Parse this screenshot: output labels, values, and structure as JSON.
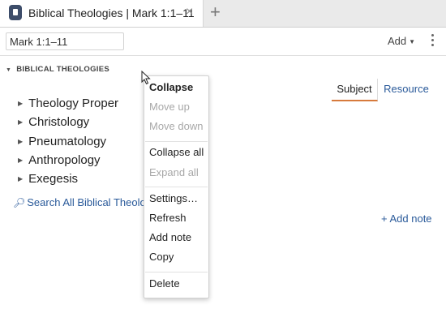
{
  "tab": {
    "title": "Biblical Theologies | Mark 1:1–11",
    "close": "×",
    "add": "+"
  },
  "toolbar": {
    "reference": "Mark 1:1–11",
    "add_label": "Add"
  },
  "section": {
    "title": "BIBLICAL THEOLOGIES"
  },
  "topics": [
    "Theology Proper",
    "Christology",
    "Pneumatology",
    "Anthropology",
    "Exegesis"
  ],
  "search_link": "Search All Biblical Theolog",
  "toggle": {
    "subject": "Subject",
    "resource": "Resource",
    "selected": "Subject"
  },
  "add_note": "+ Add note",
  "context_menu": {
    "collapse": "Collapse",
    "move_up": "Move up",
    "move_down": "Move down",
    "collapse_all": "Collapse all",
    "expand_all": "Expand all",
    "settings": "Settings…",
    "refresh": "Refresh",
    "add_note": "Add note",
    "copy": "Copy",
    "delete": "Delete"
  },
  "colors": {
    "accent": "#d77a3c",
    "link": "#2a5a9a",
    "disabled": "#a8a8a8"
  },
  "icons": [
    "resource-icon",
    "close-icon",
    "plus-icon",
    "more-vertical-icon",
    "search-icon",
    "triangle-right-icon",
    "cursor-icon"
  ]
}
